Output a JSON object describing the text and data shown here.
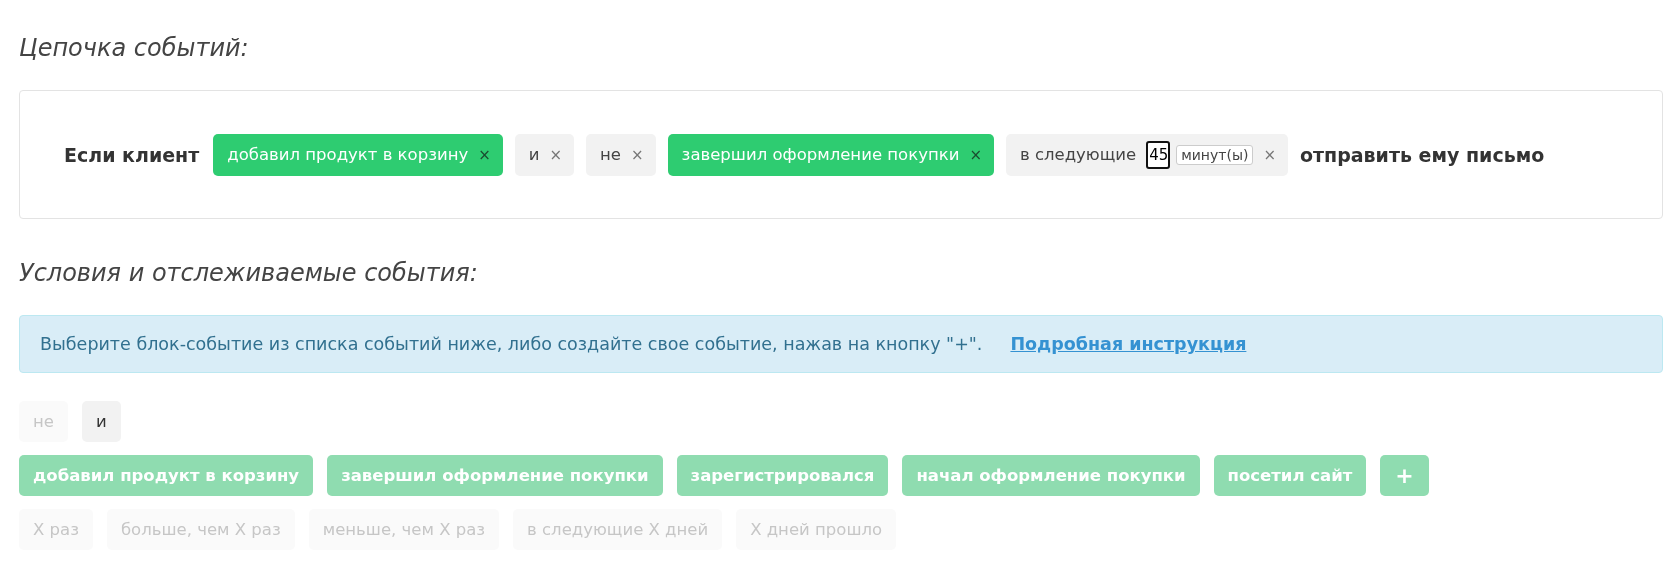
{
  "chain_title": "Цепочка событий:",
  "chain": {
    "prefix": "Если клиент",
    "suffix": "отправить ему письмо",
    "items": [
      {
        "kind": "event",
        "label": "добавил продукт в корзину",
        "remove": "×"
      },
      {
        "kind": "operator",
        "label": "и",
        "remove": "×"
      },
      {
        "kind": "operator",
        "label": "не",
        "remove": "×"
      },
      {
        "kind": "event",
        "label": "завершил оформление покупки",
        "remove": "×"
      },
      {
        "kind": "timer",
        "label": "в следующие",
        "value": "45",
        "unit": "минут(ы)",
        "remove": "×"
      }
    ]
  },
  "conditions_title": "Условия и отслеживаемые события:",
  "info": {
    "text": "Выберите блок-событие из списка событий ниже, либо создайте свое событие, нажав на кнопку \"+\".",
    "link": "Подробная инструкция"
  },
  "operators": [
    {
      "label": "не",
      "disabled": true
    },
    {
      "label": "и",
      "disabled": false
    }
  ],
  "events": [
    {
      "label": "добавил продукт в корзину",
      "disabled": true
    },
    {
      "label": "завершил оформление покупки",
      "disabled": true
    },
    {
      "label": "зарегистрировался",
      "disabled": true
    },
    {
      "label": "начал оформление покупки",
      "disabled": true
    },
    {
      "label": "посетил сайт",
      "disabled": true
    }
  ],
  "add_button": {
    "label": "+",
    "disabled": true
  },
  "modifiers": [
    {
      "label": "X раз",
      "disabled": true
    },
    {
      "label": "больше, чем X раз",
      "disabled": true
    },
    {
      "label": "меньше, чем X раз",
      "disabled": true
    },
    {
      "label": "в следующие X дней",
      "disabled": true
    },
    {
      "label": "X дней прошло",
      "disabled": true
    }
  ]
}
